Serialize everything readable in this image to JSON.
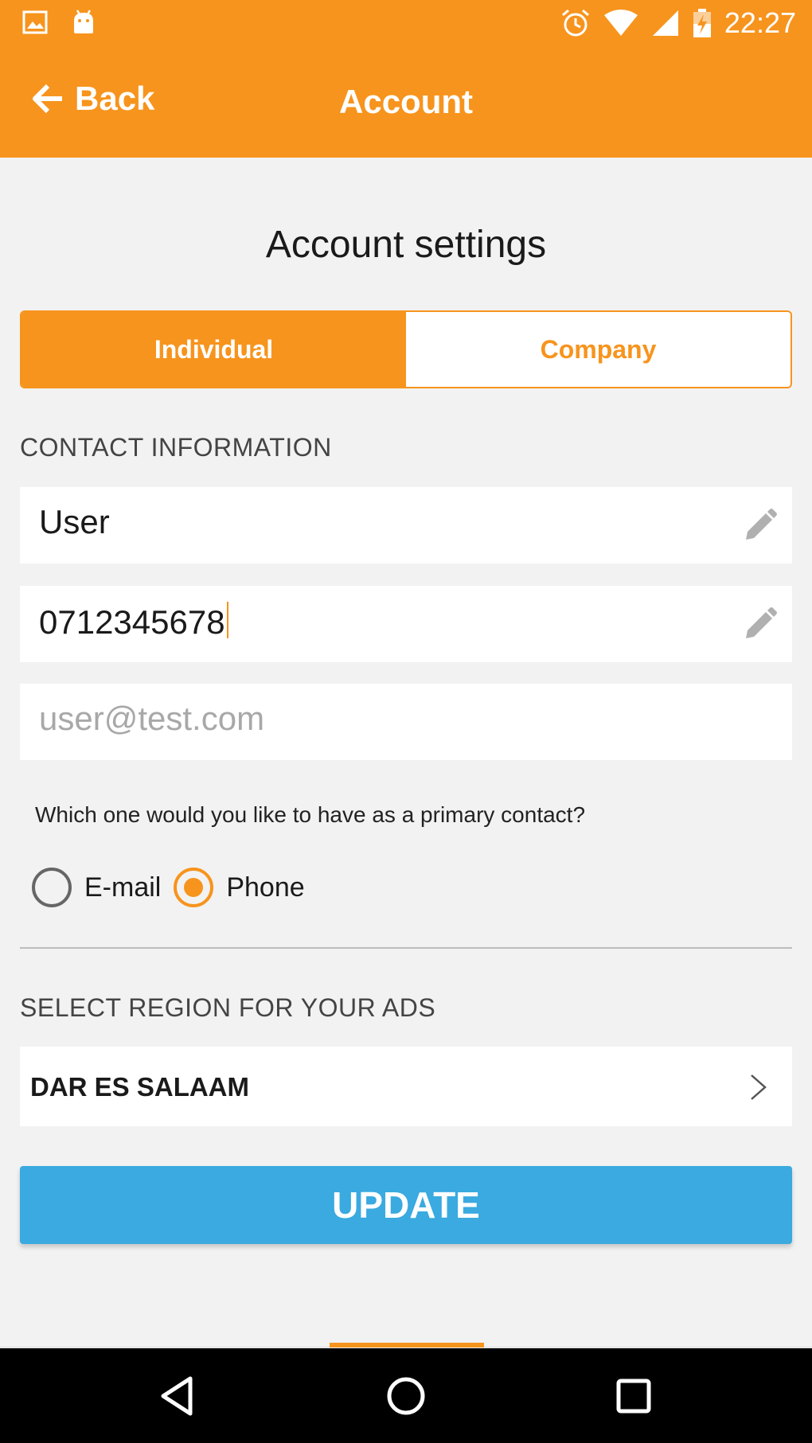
{
  "status_bar": {
    "time": "22:27",
    "left_icons": [
      "image-icon",
      "android-icon"
    ],
    "right_icons": [
      "alarm-icon",
      "wifi-icon",
      "signal-icon",
      "battery-charging-icon"
    ]
  },
  "app_bar": {
    "back_label": "Back",
    "title": "Account"
  },
  "page": {
    "title": "Account settings"
  },
  "account_type": {
    "options": [
      "Individual",
      "Company"
    ],
    "selected": "Individual"
  },
  "contact": {
    "section_label": "CONTACT INFORMATION",
    "name_value": "User",
    "phone_value": "0712345678",
    "email_placeholder": "user@test.com",
    "primary_question": "Which one would you like to have as a primary contact?",
    "primary_options": [
      "E-mail",
      "Phone"
    ],
    "primary_selected": "Phone"
  },
  "region": {
    "section_label": "SELECT REGION FOR YOUR ADS",
    "value": "DAR ES SALAAM"
  },
  "actions": {
    "update_label": "UPDATE"
  },
  "colors": {
    "accent": "#f7941d",
    "button": "#3aaae0",
    "background": "#f2f2f2"
  }
}
